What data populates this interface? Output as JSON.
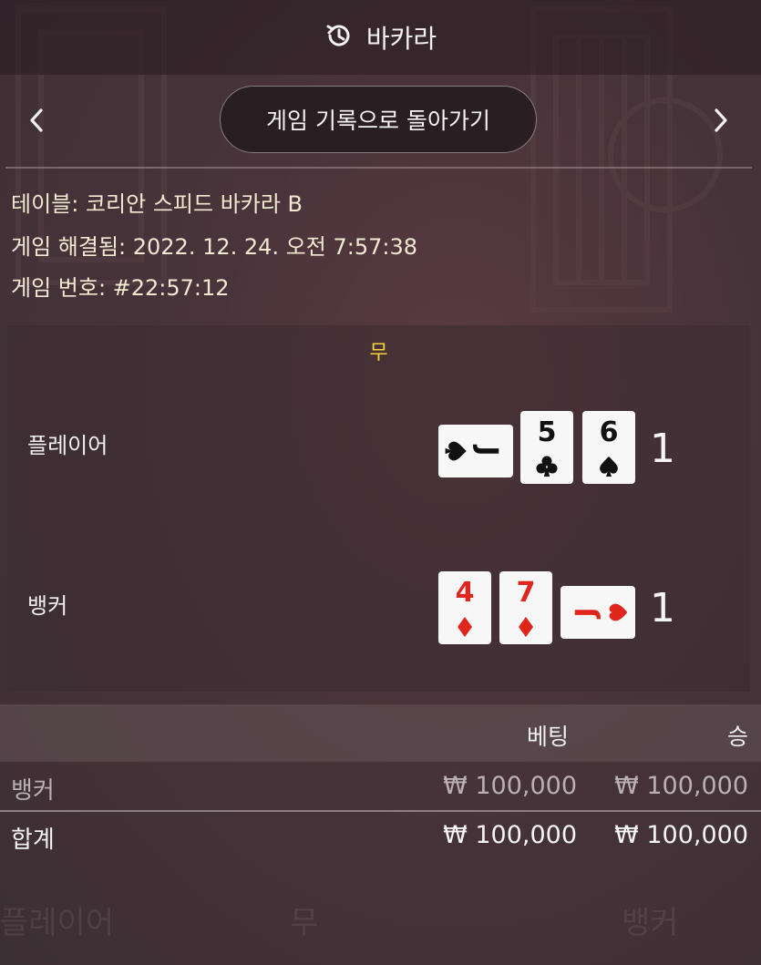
{
  "header": {
    "title": "바카라",
    "history_icon": "history-icon"
  },
  "nav": {
    "back_label": "게임 기록으로 돌아가기",
    "prev_icon": "chevron-left-icon",
    "next_icon": "chevron-right-icon"
  },
  "info": {
    "table": "테이블: 코리안 스피드 바카라 B",
    "resolved": "게임 해결됨: 2022. 12. 24. 오전 7:57:38",
    "game_number": "게임 번호: #22:57:12"
  },
  "result": {
    "outcome": "무",
    "outcome_color": "#f5d23d",
    "player": {
      "label": "플레이어",
      "score": "1",
      "cards": [
        {
          "rank": "J",
          "suit": "spade",
          "orientation": "sideways"
        },
        {
          "rank": "5",
          "suit": "club",
          "orientation": "upright"
        },
        {
          "rank": "6",
          "suit": "spade",
          "orientation": "upright"
        }
      ]
    },
    "banker": {
      "label": "뱅커",
      "score": "1",
      "cards": [
        {
          "rank": "4",
          "suit": "diamond",
          "orientation": "upright"
        },
        {
          "rank": "7",
          "suit": "diamond",
          "orientation": "upright"
        },
        {
          "rank": "J",
          "suit": "heart",
          "orientation": "sideways"
        }
      ]
    }
  },
  "summary": {
    "columns": {
      "bet": "베팅",
      "win": "승"
    },
    "rows": [
      {
        "label": "뱅커",
        "bet": "₩ 100,000",
        "win": "₩ 100,000"
      },
      {
        "label": "합계",
        "bet": "₩ 100,000",
        "win": "₩ 100,000"
      }
    ]
  },
  "footer_ghost": {
    "player": "플레이어",
    "tie": "무",
    "banker": "뱅커"
  },
  "colors": {
    "black_suit": "#111111",
    "red_suit": "#e0251c",
    "card_face": "#f7f7f7"
  }
}
